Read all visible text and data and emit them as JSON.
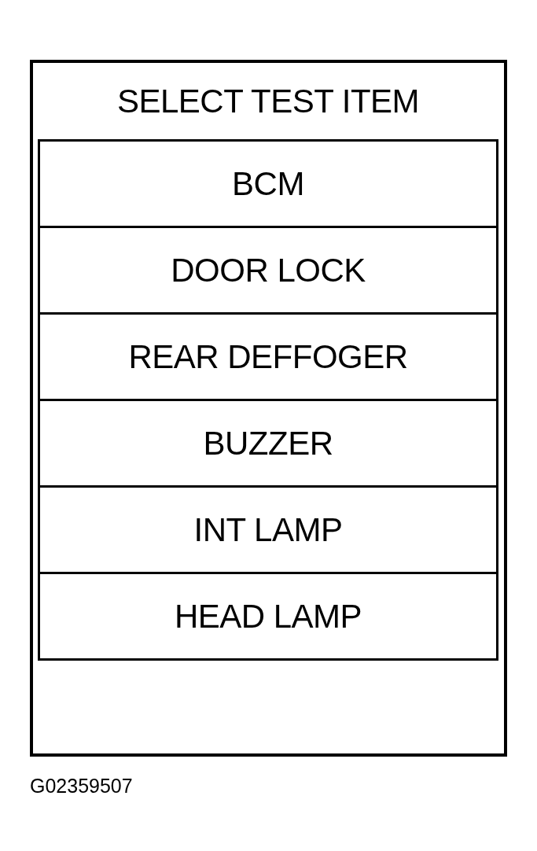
{
  "screen": {
    "title": "SELECT TEST ITEM",
    "items": [
      {
        "label": "BCM",
        "selected": false
      },
      {
        "label": "DOOR LOCK",
        "selected": false
      },
      {
        "label": "REAR DEFFOGER",
        "selected": false
      },
      {
        "label": "BUZZER",
        "selected": false
      },
      {
        "label": "INT LAMP",
        "selected": false
      },
      {
        "label": "HEAD LAMP",
        "selected": false
      }
    ]
  },
  "figure_id": "G02359507"
}
